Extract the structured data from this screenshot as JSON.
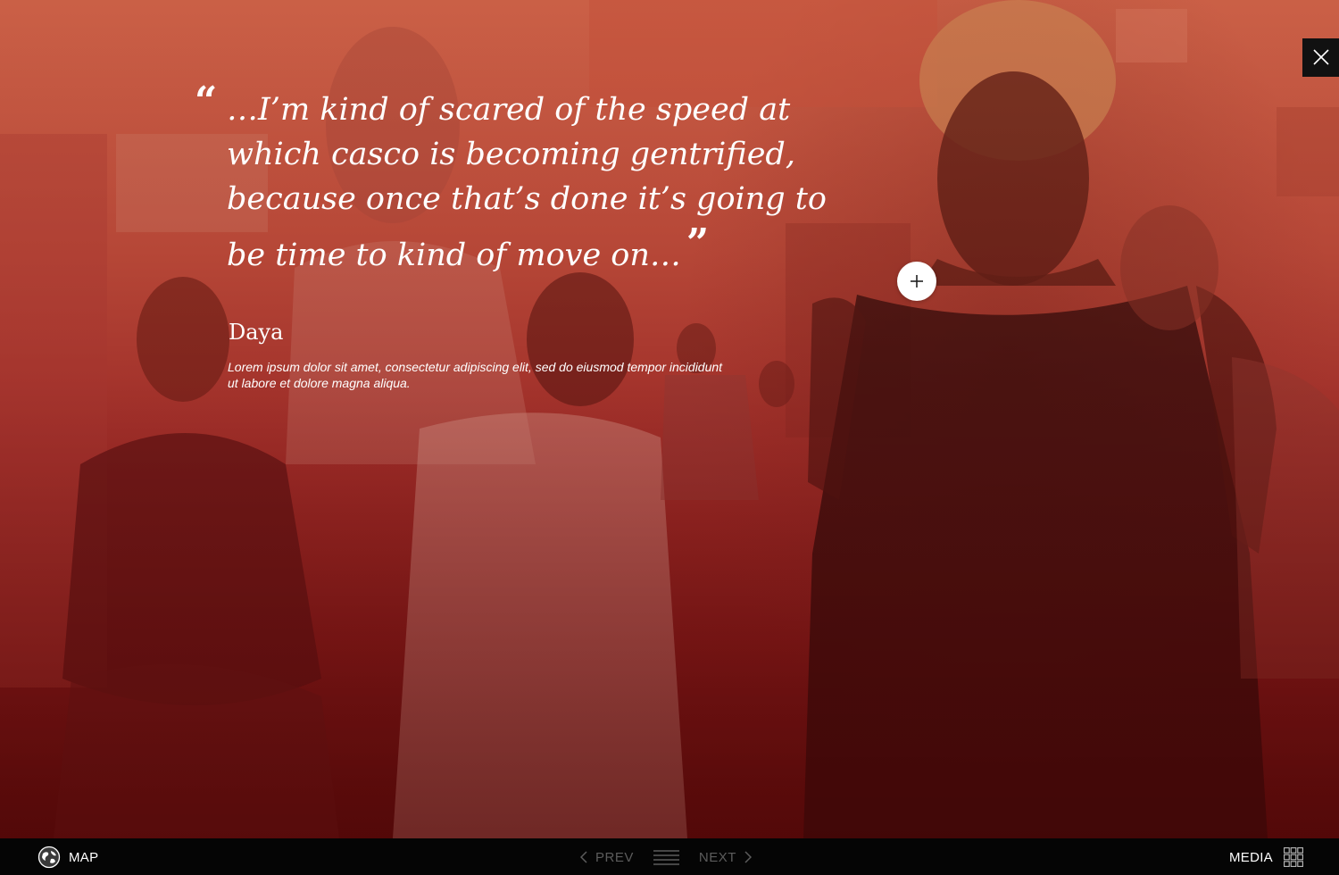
{
  "quote": {
    "open_mark": "“",
    "text": "…I’m kind of scared of the speed at which casco is becoming gentrified, because once that’s done it’s going to be time to kind of move on…",
    "close_mark": "”"
  },
  "person": {
    "name": "Daya",
    "description": "Lorem ipsum dolor sit amet, consectetur adipiscing elit, sed do eiusmod tempor incididunt ut labore et dolore magna aliqua."
  },
  "controls": {
    "close_icon": "close-icon",
    "hotspot_icon": "plus-icon"
  },
  "bottombar": {
    "map_label": "MAP",
    "map_icon": "globe-icon",
    "prev_label": "PREV",
    "next_label": "NEXT",
    "list_icon": "list-icon",
    "media_label": "MEDIA",
    "media_icon": "grid-icon"
  },
  "colors": {
    "overlay_top": "#c8624a",
    "overlay_bottom": "#4a0909",
    "bar_background": "#050505",
    "pager_disabled": "#5c5c5c"
  }
}
